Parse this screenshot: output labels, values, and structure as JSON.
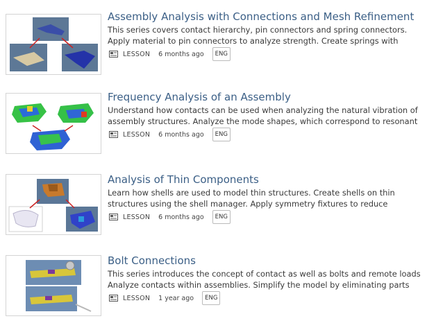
{
  "courses": [
    {
      "title": "Assembly Analysis with Connections and Mesh Refinement",
      "desc_line1": "This series covers contact hierarchy, pin connectors and spring connectors.",
      "desc_line2": "Apply material to pin connectors to analyze strength. Create springs with",
      "type": "LESSON",
      "age": "6 months ago",
      "lang": "ENG"
    },
    {
      "title": "Frequency Analysis of an Assembly",
      "desc_line1": "Understand how contacts can be used when analyzing the natural vibration of",
      "desc_line2": "assembly structures. Analyze the mode shapes, which correspond to resonant",
      "type": "LESSON",
      "age": "6 months ago",
      "lang": "ENG"
    },
    {
      "title": "Analysis of Thin Components",
      "desc_line1": "Learn how shells are used to model thin structures. Create shells on thin",
      "desc_line2": "structures using the shell manager. Apply symmetry fixtures to reduce",
      "type": "LESSON",
      "age": "6 months ago",
      "lang": "ENG"
    },
    {
      "title": "Bolt Connections",
      "desc_line1": "This series introduces the concept of contact as well as bolts and remote loads.",
      "desc_line2": "Analyze contacts within assemblies. Simplify the model by eliminating parts",
      "type": "LESSON",
      "age": "1 year ago",
      "lang": "ENG"
    }
  ]
}
